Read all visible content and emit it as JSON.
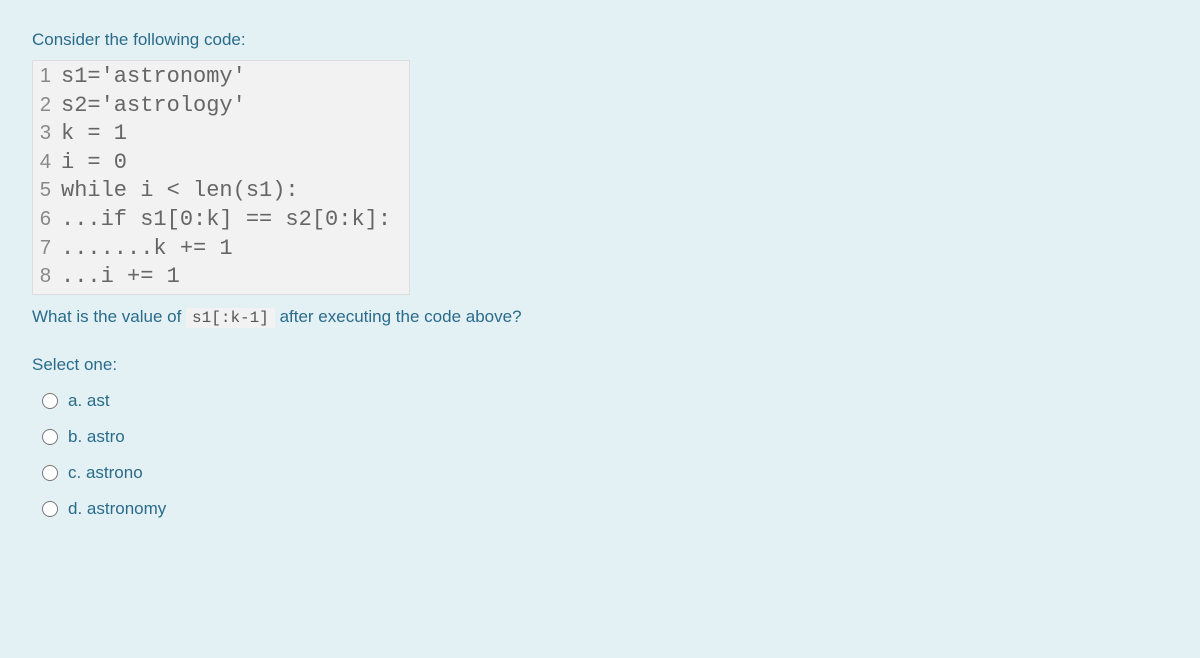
{
  "intro": "Consider the following code:",
  "code": [
    {
      "n": "1",
      "t": "s1='astronomy'"
    },
    {
      "n": "2",
      "t": "s2='astrology'"
    },
    {
      "n": "3",
      "t": "k = 1"
    },
    {
      "n": "4",
      "t": "i = 0"
    },
    {
      "n": "5",
      "t": "while i < len(s1):"
    },
    {
      "n": "6",
      "t": "...if s1[0:k] == s2[0:k]:"
    },
    {
      "n": "7",
      "t": ".......k += 1"
    },
    {
      "n": "8",
      "t": "...i += 1"
    }
  ],
  "question_pre": "What is the value of ",
  "question_code": "s1[:k-1]",
  "question_post": " after executing the code above?",
  "select_label": "Select one:",
  "options": [
    {
      "letter": "a.",
      "text": "ast"
    },
    {
      "letter": "b.",
      "text": "astro"
    },
    {
      "letter": "c.",
      "text": "astrono"
    },
    {
      "letter": "d.",
      "text": "astronomy"
    }
  ]
}
